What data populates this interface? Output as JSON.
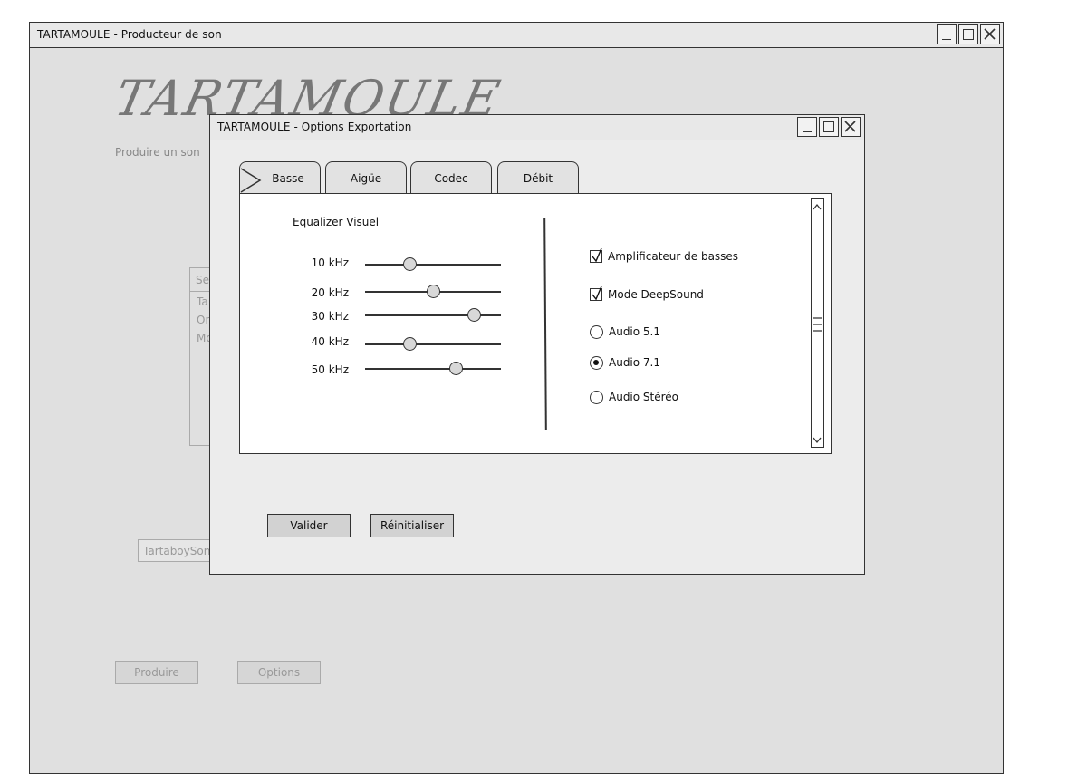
{
  "main_window": {
    "title": "TARTAMOULE - Producteur de son",
    "logo_text": "TARTAMOULE",
    "subtitle": "Produire un son",
    "list_header": "Sel",
    "list_items": [
      "Ta",
      "On",
      "Mo"
    ],
    "file_input_value": "TartaboySong",
    "produce_button": "Produire",
    "options_button": "Options"
  },
  "dialog": {
    "title": "TARTAMOULE - Options Exportation",
    "tabs": [
      {
        "label": "Basse",
        "active": true
      },
      {
        "label": "Aigüe",
        "active": false
      },
      {
        "label": "Codec",
        "active": false
      },
      {
        "label": "Débit",
        "active": false
      }
    ],
    "equalizer": {
      "title": "Equalizer Visuel",
      "bands": [
        {
          "label": "10 kHz",
          "value": 0.33
        },
        {
          "label": "20 kHz",
          "value": 0.5
        },
        {
          "label": "30 kHz",
          "value": 0.8
        },
        {
          "label": "40 kHz",
          "value": 0.33
        },
        {
          "label": "50 kHz",
          "value": 0.67
        }
      ]
    },
    "options": {
      "checkboxes": [
        {
          "label": "Amplificateur de basses",
          "checked": true
        },
        {
          "label": "Mode DeepSound",
          "checked": true
        }
      ],
      "radios": [
        {
          "label": "Audio 5.1",
          "selected": false
        },
        {
          "label": "Audio 7.1",
          "selected": true
        },
        {
          "label": "Audio Stéréo",
          "selected": false
        }
      ]
    },
    "validate_button": "Valider",
    "reset_button": "Réinitialiser"
  },
  "colors": {
    "window_bg": "#e0e0e0",
    "border": "#333333",
    "disabled_text": "#999999"
  }
}
